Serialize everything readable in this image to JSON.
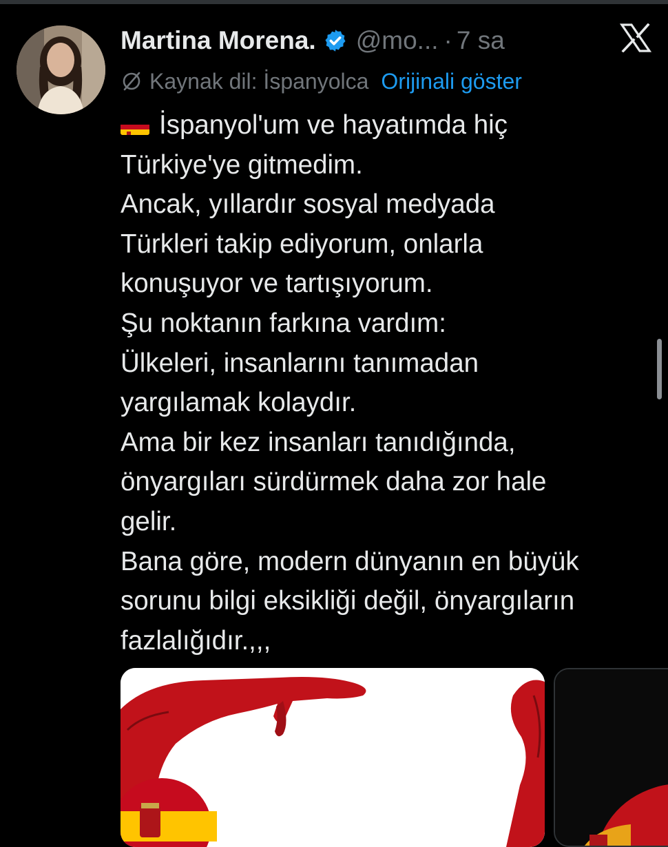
{
  "tweet": {
    "display_name": "Martina Morena.",
    "handle": "@mo...",
    "separator": "·",
    "time": "7 sa",
    "translation": {
      "source_label": "Kaynak dil: İspanyolca",
      "show_original_label": "Orijinali göster"
    },
    "flag_icon": "spain-flag-emoji",
    "text_lines": [
      "İspanyol'um ve hayatımda hiç",
      "Türkiye'ye gitmedim.",
      "Ancak, yıllardır sosyal medyada",
      "Türkleri takip ediyorum, onlarla",
      "konuşuyor ve tartışıyorum.",
      "Şu noktanın farkına vardım:",
      "Ülkeleri, insanlarını tanımadan",
      "yargılamak kolaydır.",
      "Ama bir kez insanları tanıdığında,",
      "önyargıları sürdürmek daha zor hale",
      "gelir.",
      "Bana göre, modern dünyanın en büyük",
      "sorunu bilgi eksikliği değil, önyargıların",
      "fazlalığıdır.,,,"
    ],
    "media_count": 2
  },
  "icons": {
    "verified": "verified-badge-icon",
    "x_logo": "x-logo-icon",
    "translate": "globe-slash-icon"
  },
  "colors": {
    "background": "#000000",
    "text_primary": "#e7e9ea",
    "text_secondary": "#71767b",
    "link": "#1d9bf0",
    "verified": "#1d9bf0"
  }
}
